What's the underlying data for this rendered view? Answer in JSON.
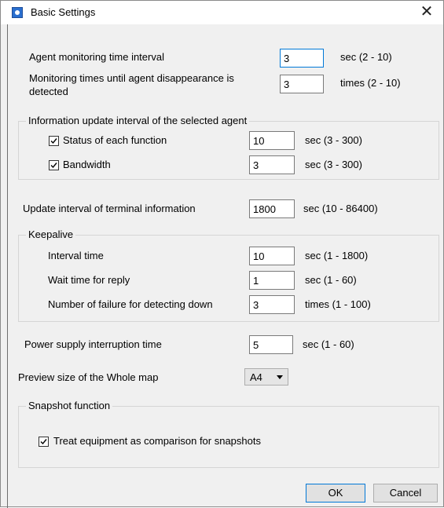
{
  "window": {
    "title": "Basic Settings",
    "close_glyph": "✕"
  },
  "agent_monitoring": {
    "label": "Agent monitoring time interval",
    "value": "3",
    "unit": "sec (2 - 10)"
  },
  "disappearance": {
    "label_line1": "Monitoring times until agent disappearance is",
    "label_line2": "detected",
    "value": "3",
    "unit": "times (2 - 10)"
  },
  "info_update": {
    "title": "Information update interval of the selected agent",
    "status": {
      "label": "Status of each function",
      "checked": true,
      "value": "10",
      "unit": "sec (3 - 300)"
    },
    "bandwidth": {
      "label": "Bandwidth",
      "checked": true,
      "value": "3",
      "unit": "sec (3 - 300)"
    }
  },
  "terminal_update": {
    "label": "Update interval of terminal information",
    "value": "1800",
    "unit": "sec (10 - 86400)"
  },
  "keepalive": {
    "title": "Keepalive",
    "interval": {
      "label": "Interval time",
      "value": "10",
      "unit": "sec (1 - 1800)"
    },
    "wait": {
      "label": "Wait time for reply",
      "value": "1",
      "unit": "sec (1 - 60)"
    },
    "failure": {
      "label": "Number of failure for detecting down",
      "value": "3",
      "unit": "times (1 - 100)"
    }
  },
  "power": {
    "label": "Power supply interruption time",
    "value": "5",
    "unit": "sec (1 - 60)"
  },
  "preview": {
    "label": "Preview size of the Whole map",
    "selected": "A4"
  },
  "snapshot": {
    "title": "Snapshot function",
    "checkbox_label": "Treat equipment as comparison for snapshots",
    "checked": true
  },
  "buttons": {
    "ok": "OK",
    "cancel": "Cancel"
  },
  "icons": {
    "title": "app-icon",
    "close": "close-icon",
    "check": "checkmark-icon",
    "dropdown": "chevron-down-icon"
  },
  "colors": {
    "accent": "#0078d7",
    "dialog_bg": "#f0f0f0",
    "titlebar_bg": "#ffffff"
  }
}
